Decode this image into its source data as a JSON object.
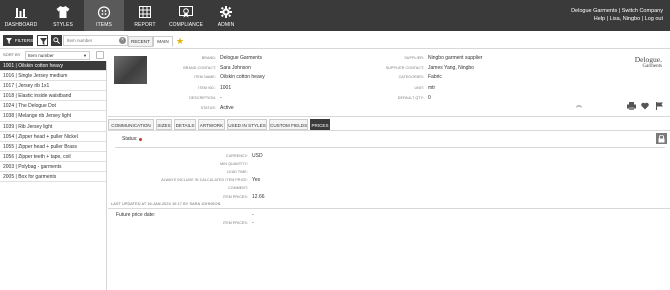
{
  "nav": {
    "items": [
      {
        "label": "DASHBOARD",
        "icon": "bar-chart-icon"
      },
      {
        "label": "STYLES",
        "icon": "shirt-icon"
      },
      {
        "label": "ITEMS",
        "icon": "button-icon"
      },
      {
        "label": "REPORT",
        "icon": "grid-icon"
      },
      {
        "label": "COMPLIANCE",
        "icon": "compliance-icon"
      },
      {
        "label": "ADMIN",
        "icon": "gear-icon"
      }
    ],
    "company_line": "Delogue Garments | Switch Company",
    "user_line": "Help | Lisa, Ningbo | Log out"
  },
  "toolbar": {
    "filters_label": "FILTERS",
    "search_placeholder": "Item number",
    "sort_label": "SORT BY",
    "sort_value": "Item number"
  },
  "top_tabs": {
    "recent": "RECENT",
    "main": "MAIN"
  },
  "items": [
    "1001 | Oilskin cotton heavy",
    "1016 | Single Jersey medium",
    "1017 | Jersey rib 1x1",
    "1018 | Elastic inside waistband",
    "1024 | The Delogue Dot",
    "1038 | Melange rib Jersey light",
    "1039 | Rib Jersey light",
    "1054 | Zipper head + puller Nickel",
    "1055 | Zipper head + puller Brass",
    "1056 | Zipper teeth + tape, coil",
    "2003 | Polybag - garments",
    "2005 | Box for garments"
  ],
  "detail": {
    "left": [
      {
        "label": "BRAND:",
        "value": "Delogue Garments"
      },
      {
        "label": "BRAND CONTACT:",
        "value": "Sara Johnson"
      },
      {
        "label": "ITEM NAME:",
        "value": "Oilskin cotton heavy"
      },
      {
        "label": "ITEM NO.:",
        "value": "1001"
      },
      {
        "label": "DESCRIPTION:",
        "value": "-"
      },
      {
        "label": "STATUS:",
        "value": "Active"
      }
    ],
    "right": [
      {
        "label": "SUPPLIER:",
        "value": "Ningbo garment supplier"
      },
      {
        "label": "SUPPLIER CONTACT:",
        "value": "James Yang, Ningbo"
      },
      {
        "label": "CATEGORIES:",
        "value": "Fabric"
      },
      {
        "label": "UNIT:",
        "value": "mtr"
      },
      {
        "label": "DEFAULT QTY:",
        "value": "0"
      }
    ],
    "logo_line1": "Delogue.",
    "logo_line2": "Garments"
  },
  "sub_tabs": [
    "COMMUNICATION",
    "SIZES",
    "DETAILS",
    "ARTWORK",
    "USED IN STYLES",
    "CUSTOM FIELDS",
    "PRICES"
  ],
  "prices": {
    "status_label": "Status:",
    "fields": [
      {
        "label": "CURRENCY:",
        "value": "USD"
      },
      {
        "label": "MIN QUANTITY:",
        "value": ""
      },
      {
        "label": "LEAD TIME:",
        "value": ""
      },
      {
        "label": "ALWAYS INCLUDE IN CALCULATED ITEM PRICE:",
        "value": "Yes"
      },
      {
        "label": "COMMENT:",
        "value": ""
      },
      {
        "label": "ITEM PRICES:",
        "value": "12.66"
      }
    ],
    "last_updated": "LAST UPDATED AT 16-JAN-2024 10:17 BY SARA JOHNSON",
    "future_label": "Future price date:",
    "future_value": "-",
    "future_item_prices_label": "ITEM PRICES:",
    "future_item_prices_value": "-"
  },
  "colors": {
    "nav_bg": "#3a3a3a",
    "accent_dark": "#3a3a3a",
    "status_dot": "#c0392b"
  }
}
